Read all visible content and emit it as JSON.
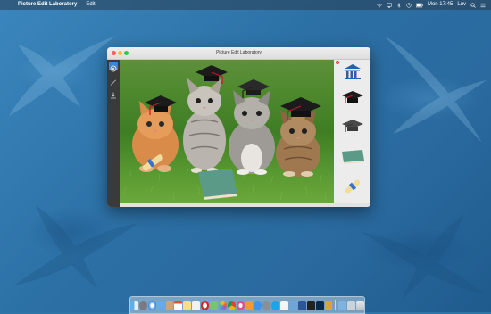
{
  "menubar": {
    "app_name": "Picture Edit Laboratory",
    "menus": [
      "Edit"
    ],
    "clock": "Mon 17:45",
    "user": "Luv"
  },
  "window": {
    "title": "Picture Edit Laboratory"
  },
  "tools": [
    {
      "name": "select-tool",
      "icon": "target-icon",
      "active": true
    },
    {
      "name": "pen-tool",
      "icon": "pen-icon",
      "active": false
    },
    {
      "name": "download-tool",
      "icon": "download-icon",
      "active": false
    }
  ],
  "stickers": [
    {
      "name": "sticker-building",
      "icon": "museum-building-icon"
    },
    {
      "name": "sticker-graduation-cap-black",
      "icon": "graduation-cap-icon"
    },
    {
      "name": "sticker-graduation-cap-gray",
      "icon": "graduation-cap-icon"
    },
    {
      "name": "sticker-book",
      "icon": "book-icon"
    },
    {
      "name": "sticker-diploma",
      "icon": "diploma-scroll-icon"
    }
  ],
  "dock_apps": [
    "finder",
    "launchpad",
    "safari",
    "mail",
    "contacts",
    "calendar",
    "notes",
    "reminders",
    "opera",
    "maps",
    "photos",
    "chrome",
    "itunes",
    "ibooks",
    "appstore",
    "preferences",
    "skype",
    "textedit",
    "preview",
    "word",
    "terminal",
    "photoshop",
    "picture-edit-lab",
    "downloads",
    "documents",
    "trash"
  ],
  "colors": {
    "accent": "#3a86d8",
    "close": "#fc605c",
    "minimize": "#fdbc40",
    "maximize": "#34c84a"
  }
}
